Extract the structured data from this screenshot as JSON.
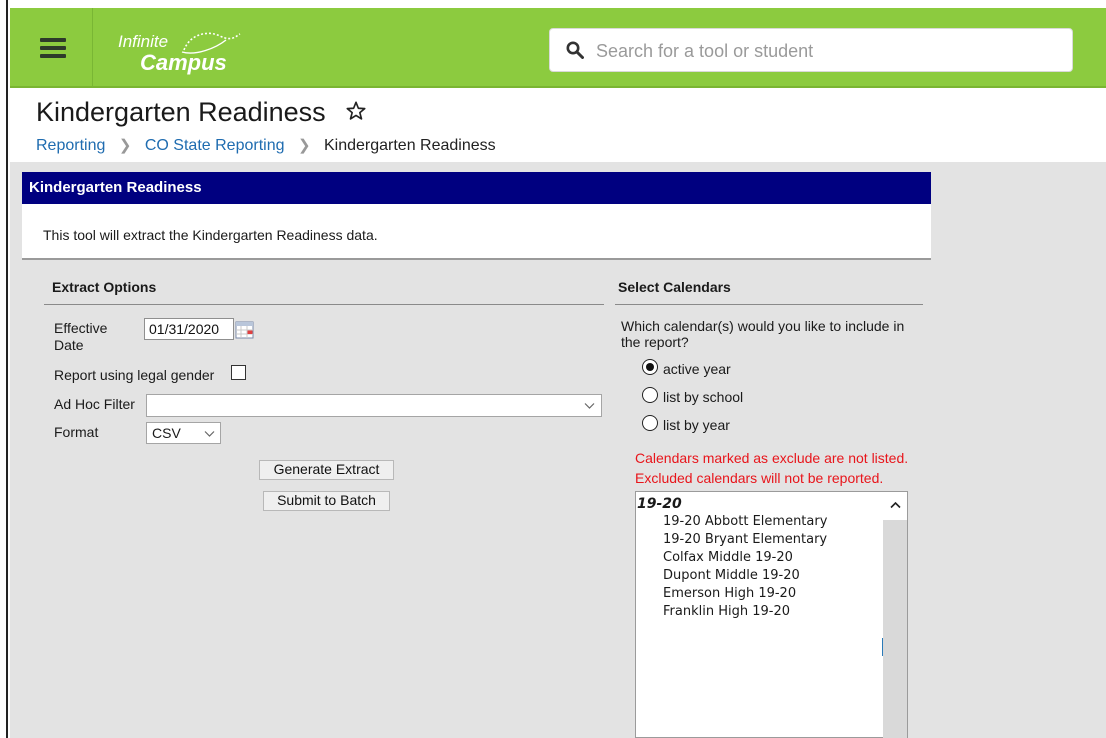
{
  "app": {
    "logo_line1": "Infinite",
    "logo_line2": "Campus",
    "search_placeholder": "Search for a tool or student",
    "brand_color": "#8ccb3f"
  },
  "page": {
    "title": "Kindergarten Readiness",
    "breadcrumbs": [
      "Reporting",
      "CO State Reporting",
      "Kindergarten Readiness"
    ]
  },
  "panel": {
    "header": "Kindergarten Readiness",
    "description": "This tool will extract the Kindergarten Readiness data.",
    "header_color": "#000080"
  },
  "extract_options": {
    "title": "Extract Options",
    "effective_date_label_1": "Effective",
    "effective_date_label_2": "Date",
    "effective_date_value": "01/31/2020",
    "legal_gender_label": "Report using legal gender",
    "legal_gender_checked": false,
    "adhoc_label": "Ad Hoc Filter",
    "adhoc_value": "",
    "format_label": "Format",
    "format_value": "CSV",
    "generate_button": "Generate Extract",
    "batch_button": "Submit to Batch"
  },
  "calendars": {
    "title": "Select Calendars",
    "question_line1": "Which calendar(s) would you like to include in",
    "question_line2": "the report?",
    "options": [
      "active year",
      "list by school",
      "list by year"
    ],
    "selected_option": "active year",
    "warning_line1": "Calendars marked as exclude are not listed.",
    "warning_line2": "Excluded calendars will not be reported.",
    "warning_color": "#e8151b",
    "group_label": "19-20",
    "items": [
      "19-20 Abbott Elementary",
      "19-20 Bryant Elementary",
      "Colfax Middle 19-20",
      "Dupont Middle 19-20",
      "Emerson High 19-20",
      "Franklin High 19-20"
    ]
  },
  "icons": [
    "menu-icon",
    "search-icon",
    "star-icon",
    "calendar-icon",
    "chevron-down-icon",
    "chevron-up-icon",
    "chevron-right-icon"
  ]
}
